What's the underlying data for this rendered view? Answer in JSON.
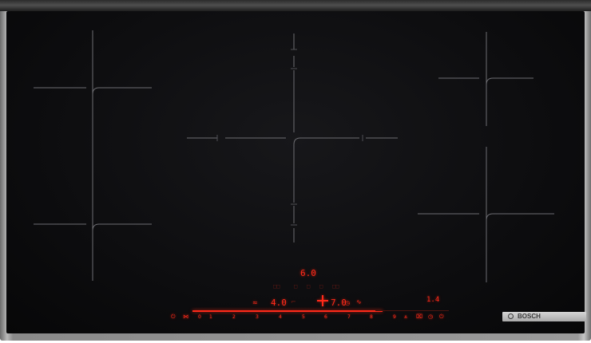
{
  "brand": "BOSCH",
  "displays": {
    "main_level": "6.0",
    "left_timer": "4.0",
    "right_timer": "7.0",
    "right_level": "1.4"
  },
  "power_scale": [
    "0",
    "1",
    "2",
    "3",
    "4",
    "5",
    "6",
    "7",
    "8",
    "9"
  ],
  "icons": {
    "flex": "flex-zone-icon",
    "timer": "timer-icon",
    "plus": "plus-icon",
    "wave": "wave-icon",
    "wipe": "wipe-protection-icon",
    "clock": "clock-icon",
    "power": "power-icon"
  },
  "colors": {
    "glass": "#0d0d0f",
    "led": "#ff2a1a",
    "marking": "#6d6d72"
  }
}
